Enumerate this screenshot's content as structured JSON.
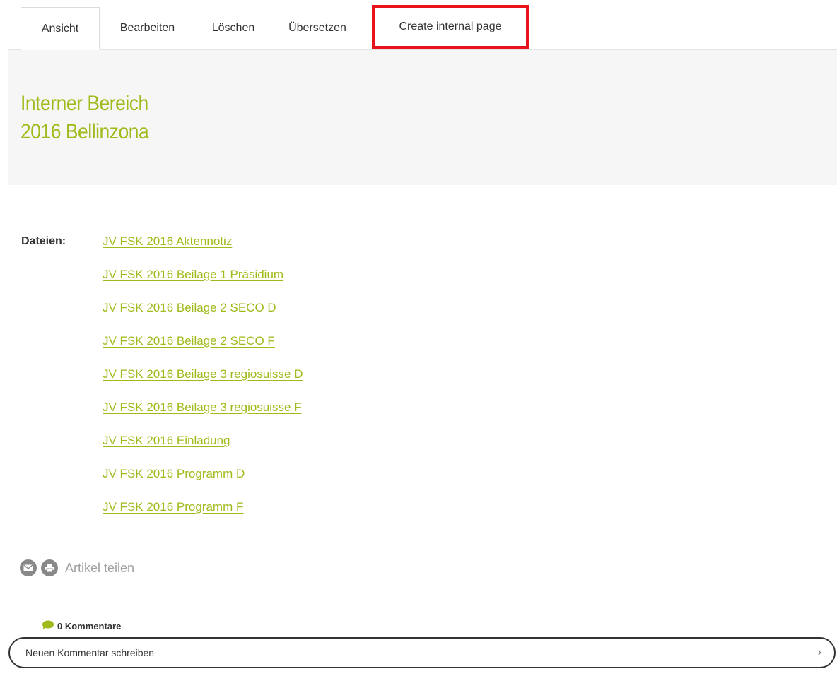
{
  "tabs": [
    {
      "label": "Ansicht",
      "active": true
    },
    {
      "label": "Bearbeiten"
    },
    {
      "label": "Löschen"
    },
    {
      "label": "Übersetzen"
    },
    {
      "label": "Create internal page",
      "highlighted": true
    }
  ],
  "header": {
    "title_line1": "Interner Bereich",
    "title_line2": "2016 Bellinzona"
  },
  "files": {
    "label": "Dateien:",
    "items": [
      "JV FSK 2016 Aktennotiz",
      "JV FSK 2016 Beilage 1 Präsidium",
      "JV FSK 2016 Beilage 2 SECO D",
      "JV FSK 2016 Beilage 2 SECO F",
      "JV FSK 2016 Beilage 3 regiosuisse D",
      "JV FSK 2016 Beilage 3 regiosuisse F",
      "JV FSK 2016 Einladung",
      "JV FSK 2016 Programm D",
      "JV FSK 2016 Programm F"
    ]
  },
  "share": {
    "label": "Artikel teilen",
    "icons": [
      "mail-icon",
      "print-icon"
    ]
  },
  "comments": {
    "count_label": "0 Kommentare",
    "new_comment_label": "Neuen Kommentar schreiben",
    "icon": "comment-bubble-icon",
    "chevron": "›"
  },
  "colors": {
    "accent": "#a1b91a",
    "highlight_border": "#e8131b",
    "header_bg": "#f6f6f6"
  }
}
